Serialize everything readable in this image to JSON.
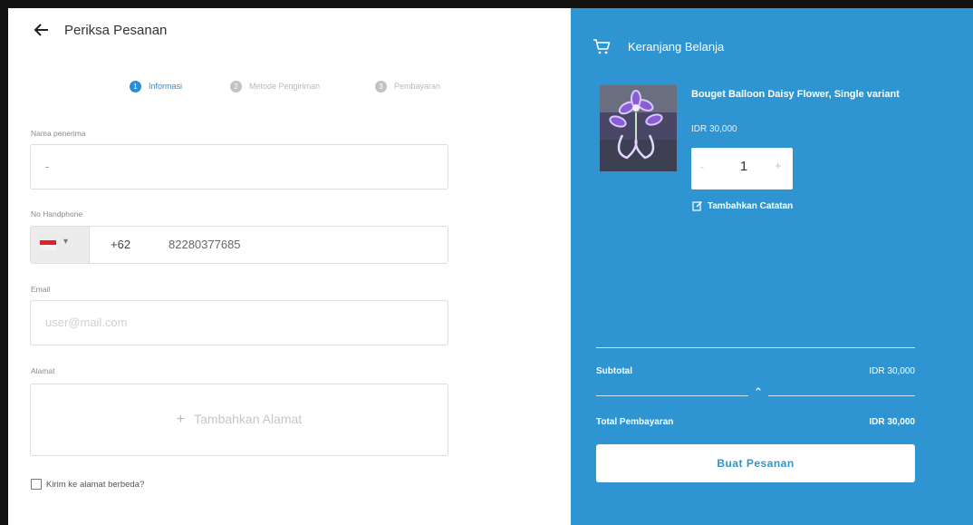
{
  "header": {
    "back_icon": "arrow-left-icon",
    "title": "Periksa Pesanan"
  },
  "steps": [
    {
      "number": "1",
      "label": "Informasi",
      "active": true
    },
    {
      "number": "2",
      "label": "Metode Pengiriman",
      "active": false
    },
    {
      "number": "3",
      "label": "Pembayaran",
      "active": false
    }
  ],
  "form": {
    "recipient": {
      "label": "Nama penerima",
      "value": "-"
    },
    "phone": {
      "label": "No Handphone",
      "country_flag": "indonesia-flag-icon",
      "dial_code": "+62",
      "value": "82280377685"
    },
    "email": {
      "label": "Email",
      "placeholder": "user@mail.com"
    },
    "address": {
      "label": "Alamat",
      "add_button": "Tambahkan Alamat"
    },
    "different_address": {
      "label": "Kirim ke alamat berbeda?",
      "checked": false
    }
  },
  "cart": {
    "title": "Keranjang Belanja",
    "icon": "cart-icon",
    "items": [
      {
        "name": "Bouget Balloon Daisy Flower, Single variant",
        "price": "IDR 30,000",
        "quantity": "1",
        "minus": "-",
        "plus": "+",
        "note_link": "Tambahkan Catatan"
      }
    ],
    "subtotal_label": "Subtotal",
    "subtotal_value": "IDR 30,000",
    "total_label": "Total Pembayaran",
    "total_value": "IDR 30,000",
    "order_button": "Buat Pesanan"
  },
  "colors": {
    "accent": "#2e95d2",
    "step_active": "#2b8fd4",
    "flag_red": "#e51e2a"
  }
}
